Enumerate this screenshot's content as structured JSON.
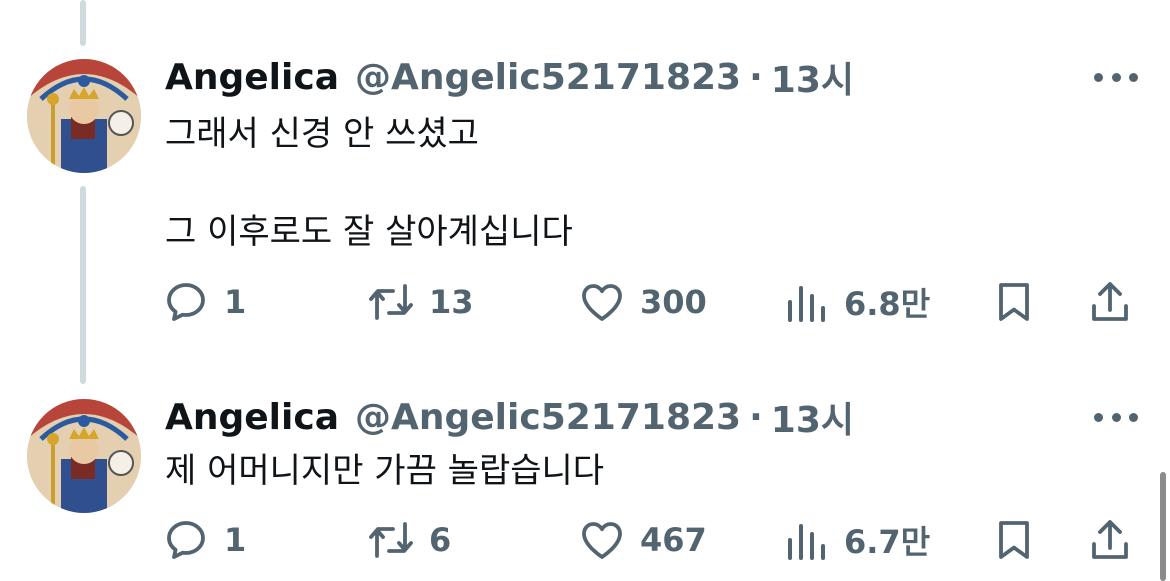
{
  "tweets": [
    {
      "author": "Angelica",
      "handle": "@Angelic52171823",
      "separator": "·",
      "time": "13시",
      "text_lines": [
        "그래서 신경 안 쓰셨고",
        "그 이후로도 잘 살아계십니다"
      ],
      "replies": "1",
      "retweets": "13",
      "likes": "300",
      "views": "6.8만"
    },
    {
      "author": "Angelica",
      "handle": "@Angelic52171823",
      "separator": "·",
      "time": "13시",
      "text_lines": [
        "제 어머니지만 가끔 놀랍습니다"
      ],
      "replies": "1",
      "retweets": "6",
      "likes": "467",
      "views": "6.7만"
    }
  ],
  "colors": {
    "text": "#0f1419",
    "secondary": "#536471",
    "thread_line": "#cfd9de"
  },
  "icons": [
    "reply-icon",
    "retweet-icon",
    "like-icon",
    "views-icon",
    "bookmark-icon",
    "share-icon",
    "more-icon"
  ]
}
